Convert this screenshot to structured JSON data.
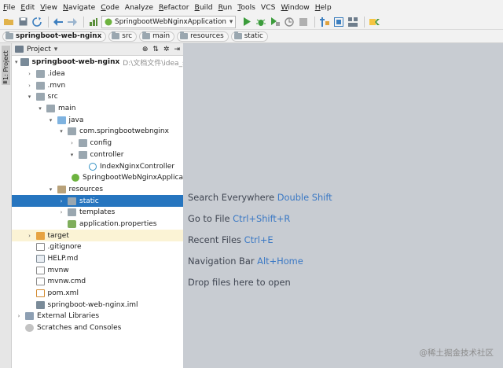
{
  "menubar": {
    "items": [
      {
        "mnemonic": "F",
        "rest": "ile"
      },
      {
        "mnemonic": "E",
        "rest": "dit"
      },
      {
        "mnemonic": "V",
        "rest": "iew"
      },
      {
        "mnemonic": "N",
        "rest": "avigate"
      },
      {
        "mnemonic": "C",
        "rest": "ode"
      },
      {
        "mnemonic": "",
        "rest": "Analyze"
      },
      {
        "mnemonic": "R",
        "rest": "efactor"
      },
      {
        "mnemonic": "B",
        "rest": "uild"
      },
      {
        "mnemonic": "R",
        "rest": "un"
      },
      {
        "mnemonic": "T",
        "rest": "ools"
      },
      {
        "mnemonic": "",
        "rest": "VCS"
      },
      {
        "mnemonic": "W",
        "rest": "indow"
      },
      {
        "mnemonic": "H",
        "rest": "elp"
      }
    ]
  },
  "toolbar": {
    "run_config": "SpringbootWebNginxApplication",
    "run_config_arrow": "▾",
    "icons": {
      "open": "open-folder-icon",
      "save": "save-icon",
      "sync": "sync-icon",
      "back": "back-arrow-icon",
      "forward": "forward-arrow-icon",
      "build": "build-icon",
      "run": "run-icon",
      "debug": "debug-icon",
      "coverage": "coverage-icon",
      "profile": "profile-icon",
      "stop": "stop-icon",
      "project_structure": "project-structure-icon",
      "sdk": "sdk-icon",
      "layout": "layout-icon",
      "maven": "maven-icon"
    }
  },
  "breadcrumbs": [
    "springboot-web-nginx",
    "src",
    "main",
    "resources",
    "static"
  ],
  "left_stripe": {
    "project_tab": "1: Project",
    "structure_tab": "≡"
  },
  "panel": {
    "title": "Project",
    "dropdown_arrow": "▾",
    "icons": {
      "locate": "⊕",
      "collapse": "⇅",
      "settings": "✲",
      "hide": "⇥"
    }
  },
  "tree": [
    {
      "indent": 0,
      "arrow": "▾",
      "icon": "module",
      "label": "springboot-web-nginx",
      "bold": true,
      "hint": "D:\\文档文件\\idea_sour"
    },
    {
      "indent": 1,
      "arrow": "›",
      "icon": "folder",
      "label": ".idea"
    },
    {
      "indent": 1,
      "arrow": "›",
      "icon": "folder",
      "label": ".mvn"
    },
    {
      "indent": 1,
      "arrow": "▾",
      "icon": "folder",
      "label": "src"
    },
    {
      "indent": 2,
      "arrow": "▾",
      "icon": "folder",
      "label": "main"
    },
    {
      "indent": 3,
      "arrow": "▾",
      "icon": "src",
      "label": "java"
    },
    {
      "indent": 4,
      "arrow": "▾",
      "icon": "folder",
      "label": "com.springbootwebnginx"
    },
    {
      "indent": 5,
      "arrow": "›",
      "icon": "folder",
      "label": "config"
    },
    {
      "indent": 5,
      "arrow": "▾",
      "icon": "folder",
      "label": "controller"
    },
    {
      "indent": 6,
      "arrow": "",
      "icon": "class",
      "label": "IndexNginxController"
    },
    {
      "indent": 5,
      "arrow": "",
      "icon": "spring",
      "label": "SpringbootWebNginxApplica"
    },
    {
      "indent": 3,
      "arrow": "▾",
      "icon": "res",
      "label": "resources"
    },
    {
      "indent": 4,
      "arrow": "›",
      "icon": "folder",
      "label": "static",
      "selected": true
    },
    {
      "indent": 4,
      "arrow": "›",
      "icon": "folder",
      "label": "templates"
    },
    {
      "indent": 4,
      "arrow": "",
      "icon": "props",
      "label": "application.properties"
    },
    {
      "indent": 1,
      "arrow": "›",
      "icon": "target",
      "label": "target",
      "excluded": true
    },
    {
      "indent": 1,
      "arrow": "",
      "icon": "file",
      "label": ".gitignore"
    },
    {
      "indent": 1,
      "arrow": "",
      "icon": "md",
      "label": "HELP.md"
    },
    {
      "indent": 1,
      "arrow": "",
      "icon": "file",
      "label": "mvnw"
    },
    {
      "indent": 1,
      "arrow": "",
      "icon": "file",
      "label": "mvnw.cmd"
    },
    {
      "indent": 1,
      "arrow": "",
      "icon": "xml",
      "label": "pom.xml"
    },
    {
      "indent": 1,
      "arrow": "",
      "icon": "module",
      "label": "springboot-web-nginx.iml"
    },
    {
      "indent": 0,
      "arrow": "›",
      "icon": "lib",
      "label": "External Libraries"
    },
    {
      "indent": 0,
      "arrow": "",
      "icon": "scratch",
      "label": "Scratches and Consoles"
    }
  ],
  "editor_hints": [
    {
      "text": "Search Everywhere",
      "key": "Double Shift"
    },
    {
      "text": "Go to File",
      "key": "Ctrl+Shift+R"
    },
    {
      "text": "Recent Files",
      "key": "Ctrl+E"
    },
    {
      "text": "Navigation Bar",
      "key": "Alt+Home"
    },
    {
      "text": "Drop files here to open",
      "key": ""
    }
  ],
  "watermark": "@稀土掘金技术社区",
  "colors": {
    "selection": "#2675bf",
    "editor_bg": "#c8ccd2",
    "shortcut": "#3a78c4",
    "excluded_row": "#fbf3d5"
  }
}
